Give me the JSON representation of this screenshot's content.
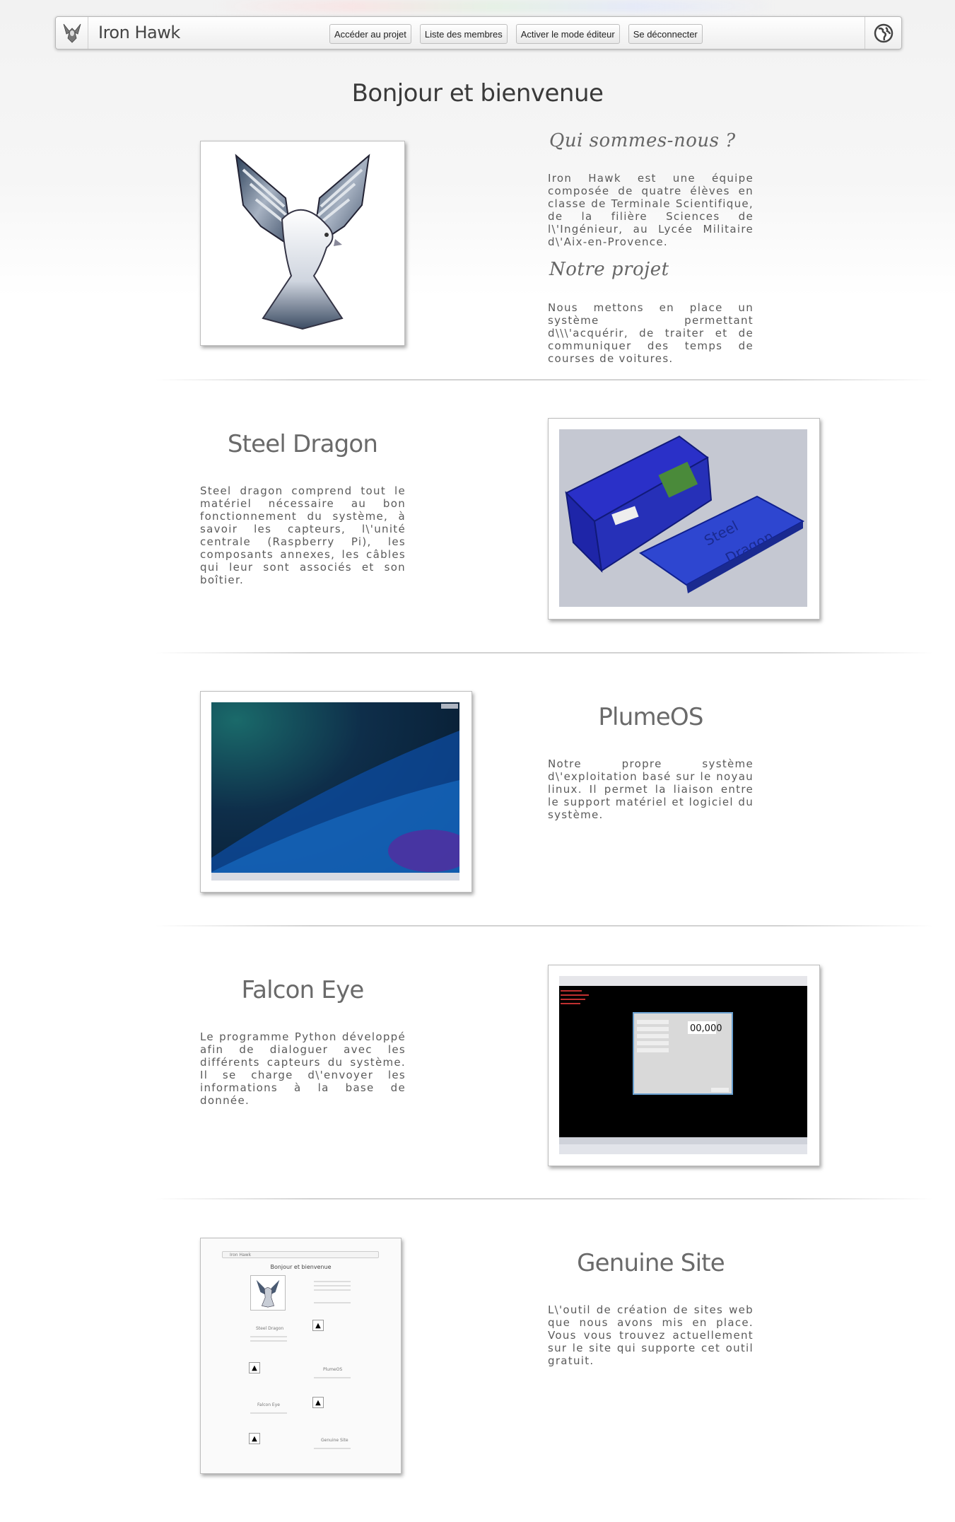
{
  "navbar": {
    "brand": "Iron Hawk",
    "buttons": [
      "Accéder au projet",
      "Liste des membres",
      "Activer le mode éditeur",
      "Se déconnecter"
    ],
    "icons": {
      "brand": "hawk-logo-icon",
      "right": "globe-icon"
    }
  },
  "page_title": "Bonjour et bienvenue",
  "intro": {
    "heading_who": "Qui sommes-nous ?",
    "text_who": "Iron Hawk est une équipe composée de quatre élèves en classe de Terminale Scientifique, de la filière Sciences de l\\'Ingénieur, au Lycée Militaire d\\'Aix-en-Provence.",
    "heading_project": "Notre projet",
    "text_project": "Nous mettons en place un système permettant d\\\\\\'acquérir, de traiter et de communiquer des temps de courses de voitures."
  },
  "sections": [
    {
      "title": "Steel Dragon",
      "text": "Steel dragon comprend tout le matériel nécessaire au bon fonctionnement du système, à savoir les capteurs, l\\'unité centrale (Raspberry Pi), les composants annexes, les câbles qui leur sont associés et son boîtier.",
      "image_label_1": "Steel",
      "image_label_2": "Dragon"
    },
    {
      "title": "PlumeOS",
      "text": "Notre propre système d\\'exploitation basé sur le noyau linux. Il permet la liaison entre le support matériel et logiciel du système."
    },
    {
      "title": "Falcon Eye",
      "text": "Le programme Python développé afin de dialoguer avec les différents capteurs du système. Il se charge d\\'envoyer les informations à la base de donnée.",
      "image_counter": "00,000"
    },
    {
      "title": "Genuine Site",
      "text": "L\\'outil de création de sites web que nous avons mis en place. Vous vous trouvez actuellement sur le site qui supporte cet outil gratuit.",
      "preview": {
        "brand": "Iron Hawk",
        "title": "Bonjour et bienvenue",
        "items": [
          "Steel Dragon",
          "PlumeOS",
          "Falcon Eye",
          "Genuine Site"
        ]
      }
    }
  ],
  "colors": {
    "text": "#5a5a5a",
    "heading": "#6a6a6a",
    "frame_border": "#bdbdbd"
  }
}
